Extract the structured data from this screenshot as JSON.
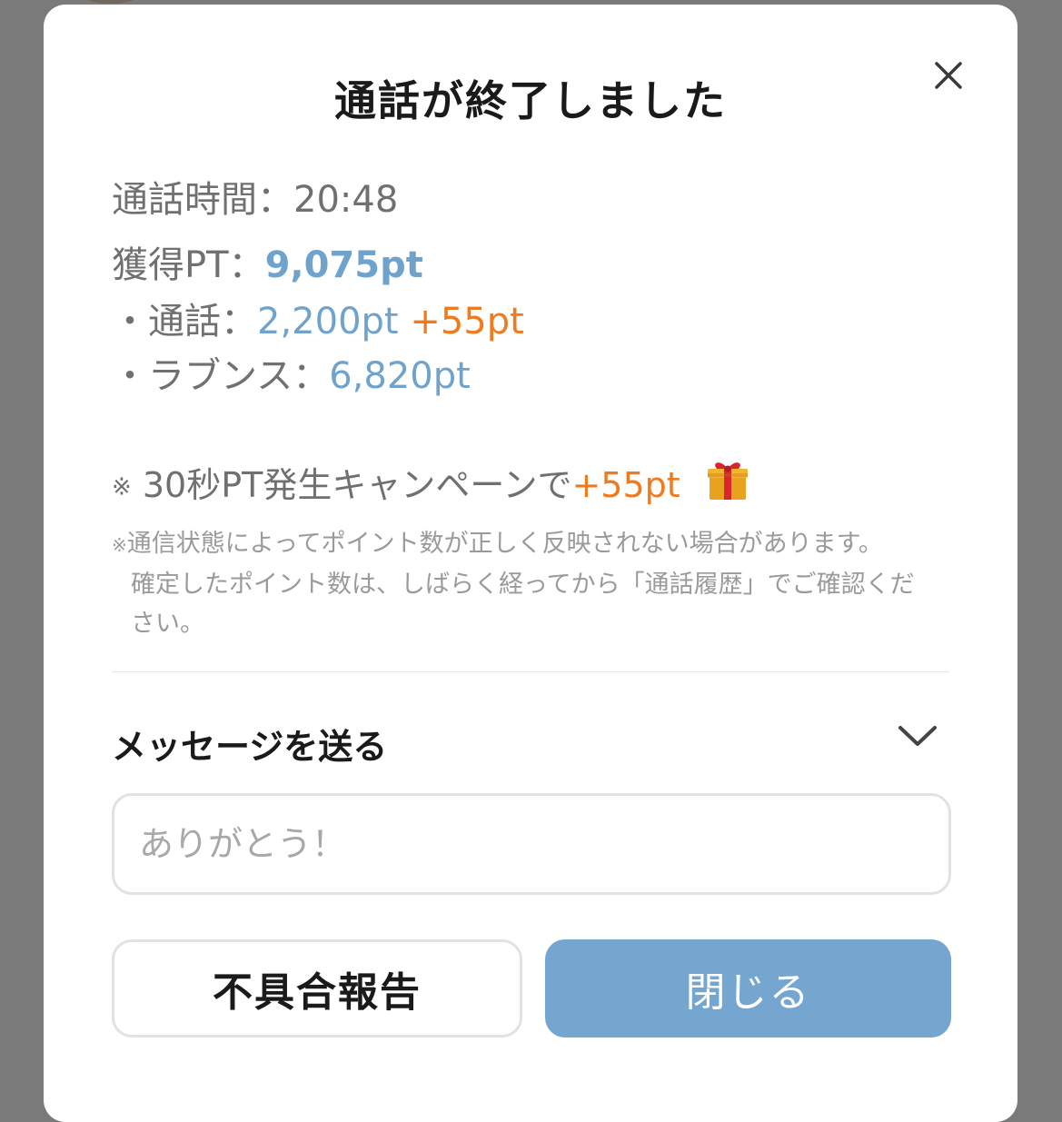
{
  "dialog": {
    "title": "通話が終了しました",
    "close_icon": "close-icon"
  },
  "summary": {
    "duration_label": "通話時間：",
    "duration_value": "20:48",
    "total_label": "獲得PT：",
    "total_value": "9,075pt",
    "call_label": "・通話：",
    "call_value": "2,200pt",
    "call_bonus": "+55pt",
    "lovense_label": "・ラブンス：",
    "lovense_value": "6,820pt"
  },
  "campaign": {
    "mark": "※",
    "text": " 30秒PT発生キャンペーンで",
    "bonus": "+55pt",
    "icon": "gift-icon"
  },
  "notice": {
    "mark": "※",
    "line1": "通信状態によってポイント数が正しく反映されない場合があります。",
    "line2": "確定したポイント数は、しばらく経ってから「通話履歴」でご確認くだ",
    "line3": "さい。"
  },
  "message": {
    "title": "メッセージを送る",
    "toggle_icon": "chevron-down-icon",
    "placeholder": "ありがとう！"
  },
  "buttons": {
    "report_label": "不具合報告",
    "close_label": "閉じる"
  },
  "colors": {
    "accent_blue": "#6fa3cc",
    "bonus_orange": "#f07a1e",
    "primary_button": "#74a6cf",
    "overlay": "#7a7a7a"
  }
}
